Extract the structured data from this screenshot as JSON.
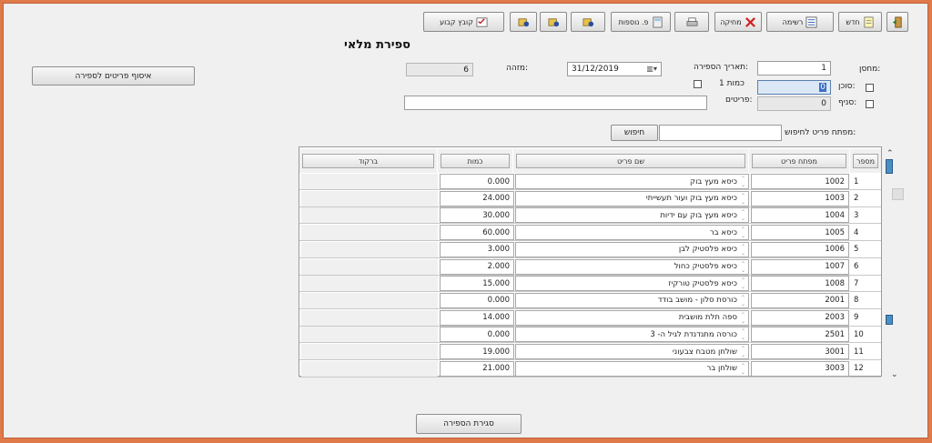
{
  "toolbar": {
    "exit": "",
    "new": "חדש",
    "list": "רשימה",
    "delete": "מחיקה",
    "print": "",
    "more": "פ. נוספות",
    "key1": "",
    "key2": "",
    "key3": "",
    "fixed_files": "קובץ קבוע"
  },
  "form": {
    "title": "ספירת מלאי",
    "warehouse_label": "מחסן:",
    "warehouse_value": "1",
    "agent_label": "סוכן:",
    "agent_value": "0",
    "branch_label": "סניף:",
    "branch_value": "0",
    "count_date_label": "תאריך הספירה:",
    "count_date_value": "31/12/2019",
    "qty1_label": "כמות 1",
    "items_label": "פריטים:",
    "items_value": "",
    "id_label": "מזהה:",
    "id_value": "6",
    "add_items_button": "איסוף פריטים לספירה",
    "search_label": "מפתח פריט לחיפוש:",
    "search_value": "",
    "search_button": "חיפוש",
    "close_count_button": "סגירת הספירה"
  },
  "grid": {
    "columns": {
      "num": "מספר",
      "code": "מפתח פריט",
      "name": "שם פריט",
      "qty": "כמות",
      "barcode": "ברקוד"
    },
    "rows": [
      {
        "num": "1",
        "code": "1002",
        "name": "כיסא מעץ בוק",
        "qty": "0.000"
      },
      {
        "num": "2",
        "code": "1003",
        "name": "כיסא מעץ בוק ועור תעשייתי",
        "qty": "24.000"
      },
      {
        "num": "3",
        "code": "1004",
        "name": "כיסא מעץ בוק עם ידיות",
        "qty": "30.000"
      },
      {
        "num": "4",
        "code": "1005",
        "name": "כיסא בר",
        "qty": "60.000"
      },
      {
        "num": "5",
        "code": "1006",
        "name": "כיסא פלסטיק לבן",
        "qty": "3.000"
      },
      {
        "num": "6",
        "code": "1007",
        "name": "כיסא פלסטיק כחול",
        "qty": "2.000"
      },
      {
        "num": "7",
        "code": "1008",
        "name": "כיסא פלסטיק טורקיז",
        "qty": "15.000"
      },
      {
        "num": "8",
        "code": "2001",
        "name": "כורסת סלון - מושב בודד",
        "qty": "0.000"
      },
      {
        "num": "9",
        "code": "2003",
        "name": "ספה תלת מושבית",
        "qty": "14.000"
      },
      {
        "num": "10",
        "code": "2501",
        "name": "כורסה מתנדנדת לגיל ה- 3",
        "qty": "0.000"
      },
      {
        "num": "11",
        "code": "3001",
        "name": "שולחן מטבח צבעוני",
        "qty": "19.000"
      },
      {
        "num": "12",
        "code": "3003",
        "name": "שולחן בר",
        "qty": "21.000"
      }
    ]
  }
}
